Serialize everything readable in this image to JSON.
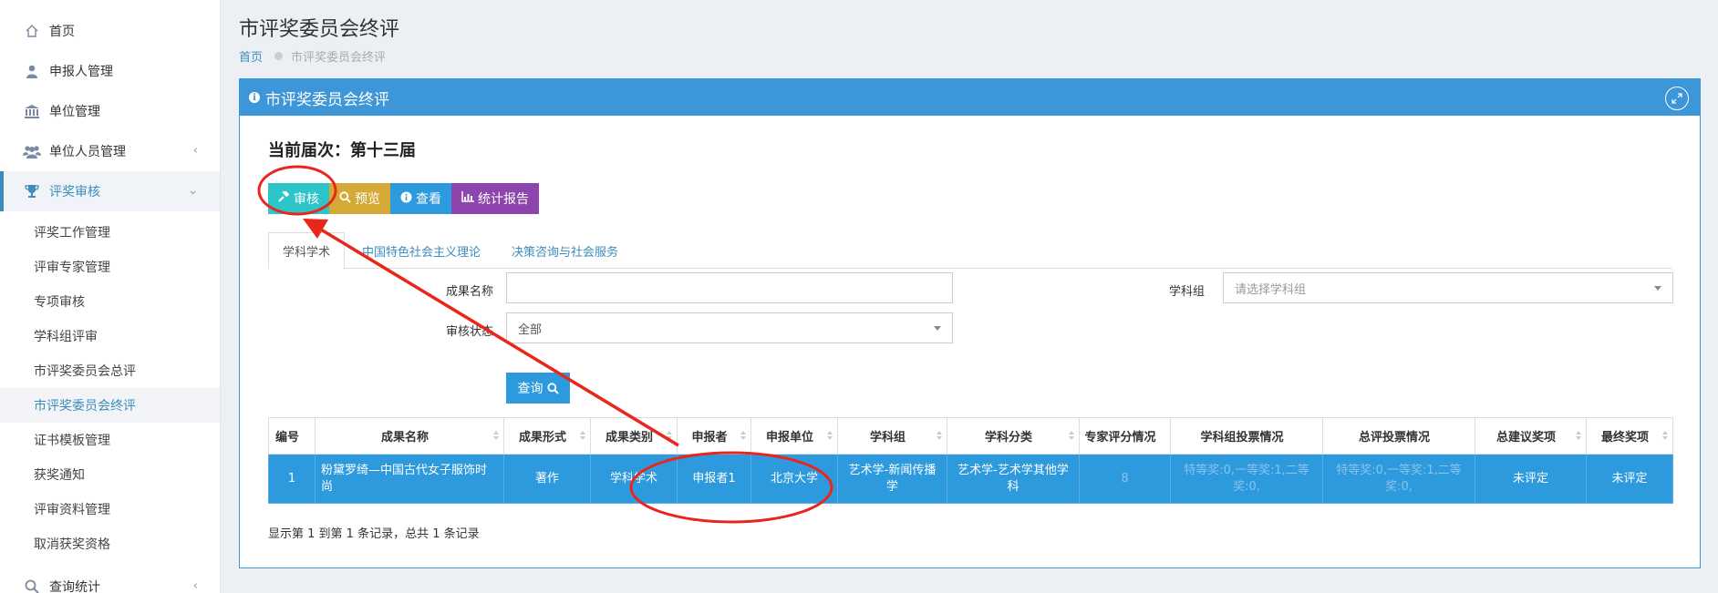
{
  "sidebar": {
    "items": [
      {
        "label": "首页",
        "icon": "home-icon"
      },
      {
        "label": "申报人管理",
        "icon": "user-icon"
      },
      {
        "label": "单位管理",
        "icon": "bank-icon"
      },
      {
        "label": "单位人员管理",
        "icon": "users-icon",
        "chevron": "‹"
      },
      {
        "label": "评奖审核",
        "icon": "trophy-icon",
        "chevron": "⌄"
      }
    ],
    "subitems": [
      "评奖工作管理",
      "评审专家管理",
      "专项审核",
      "学科组评审",
      "市评奖委员会总评",
      "市评奖委员会终评",
      "证书模板管理",
      "获奖通知",
      "评审资料管理",
      "取消获奖资格"
    ],
    "bottom_item": {
      "label": "查询统计",
      "icon": "search-icon",
      "chevron": "‹"
    }
  },
  "header": {
    "title": "市评奖委员会终评",
    "breadcrumb_home": "首页",
    "breadcrumb_current": "市评奖委员会终评"
  },
  "panel": {
    "title": "市评奖委员会终评",
    "session_label": "当前届次：第十三届",
    "buttons": {
      "audit": "审核",
      "preview": "预览",
      "view": "查看",
      "report": "统计报告"
    },
    "tabs": [
      "学科学术",
      "中国特色社会主义理论",
      "决策咨询与社会服务"
    ]
  },
  "filters": {
    "name_label": "成果名称",
    "name_value": "",
    "group_label": "学科组",
    "group_placeholder": "请选择学科组",
    "status_label": "审核状态",
    "status_value": "全部",
    "search_label": "查询"
  },
  "table": {
    "headers": [
      "编号",
      "成果名称",
      "成果形式",
      "成果类别",
      "申报者",
      "申报单位",
      "学科组",
      "学科分类",
      "专家评分情况",
      "学科组投票情况",
      "总评投票情况",
      "总建议奖项",
      "最终奖项"
    ],
    "rows": [
      [
        "1",
        "粉黛罗绮—中国古代女子服饰时尚",
        "著作",
        "学科学术",
        "申报者1",
        "北京大学",
        "艺术学-新闻传播学",
        "艺术学-艺术学其他学科",
        "8",
        "特等奖:0,一等奖:1,二等奖:0,",
        "特等奖:0,一等奖:1,二等奖:0,",
        "未评定",
        "未评定"
      ]
    ]
  },
  "pagination_info": "显示第 1 到第 1 条记录，总共 1 条记录",
  "colors": {
    "primary": "#3c96d8",
    "audit_button": "#2ec5c8",
    "preview_button": "#d4a935",
    "view_button": "#2e9ade",
    "report_button": "#8e44ad",
    "annotation": "#e8261c"
  }
}
